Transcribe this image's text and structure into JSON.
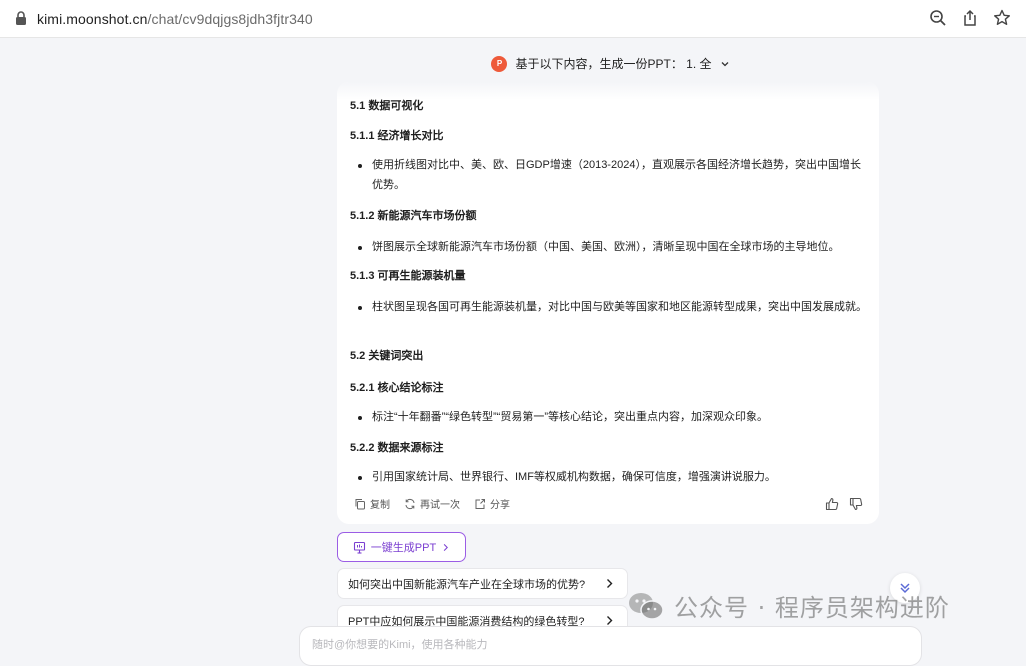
{
  "browser": {
    "url_host": "kimi.moonshot.cn",
    "url_path": "/chat/cv9dqjgs8jdh3fjtr340"
  },
  "chat": {
    "title": "基于以下内容，生成一份PPT： 1. 全"
  },
  "message": {
    "blocks": [
      {
        "type": "heading",
        "text": "5.1 数据可视化"
      },
      {
        "type": "heading",
        "text": "5.1.1 经济增长对比"
      },
      {
        "type": "bullet",
        "text": "使用折线图对比中、美、欧、日GDP增速（2013-2024），直观展示各国经济增长趋势，突出中国增长优势。"
      },
      {
        "type": "heading",
        "text": "5.1.2 新能源汽车市场份额"
      },
      {
        "type": "bullet",
        "text": "饼图展示全球新能源汽车市场份额（中国、美国、欧洲），清晰呈现中国在全球市场的主导地位。"
      },
      {
        "type": "heading",
        "text": "5.1.3 可再生能源装机量"
      },
      {
        "type": "bullet",
        "text": "柱状图呈现各国可再生能源装机量，对比中国与欧美等国家和地区能源转型成果，突出中国发展成就。"
      },
      {
        "type": "heading",
        "text": "5.2 关键词突出"
      },
      {
        "type": "heading",
        "text": "5.2.1 核心结论标注"
      },
      {
        "type": "bullet",
        "text": "标注“十年翻番”“绿色转型”“贸易第一”等核心结论，突出重点内容，加深观众印象。"
      },
      {
        "type": "heading",
        "text": "5.2.2 数据来源标注"
      },
      {
        "type": "bullet",
        "text": "引用国家统计局、世界银行、IMF等权威机构数据，确保可信度，增强演讲说服力。"
      }
    ],
    "actions": {
      "copy": "复制",
      "retry": "再试一次",
      "share": "分享"
    }
  },
  "generate_ppt": {
    "label": "一键生成PPT"
  },
  "suggestions": [
    "如何突出中国新能源汽车产业在全球市场的优势?",
    "PPT中应如何展示中国能源消费结构的绿色转型?"
  ],
  "watermark": {
    "text": "公众号 · 程序员架构进阶"
  },
  "input": {
    "placeholder": "随时@你想要的Kimi，使用各种能力"
  },
  "colors": {
    "accent_purple": "#7b3fd1",
    "ppt_icon": "#ee5a3a",
    "page_bg": "#f4f5f8"
  }
}
